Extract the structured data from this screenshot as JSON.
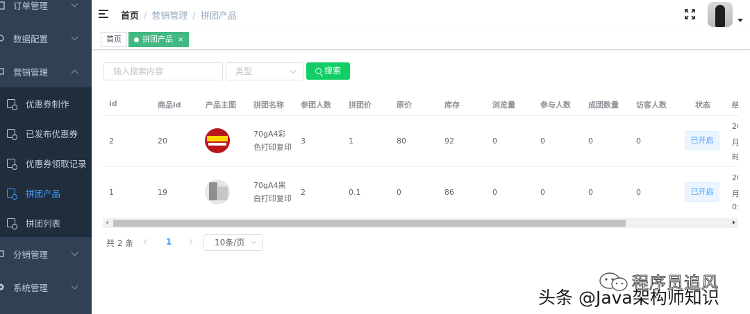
{
  "sidebar": {
    "menus": [
      {
        "label": "订单管理",
        "icon": "order-icon",
        "expanded": false
      },
      {
        "label": "数据配置",
        "icon": "config-icon",
        "expanded": false
      },
      {
        "label": "营销管理",
        "icon": "marketing-icon",
        "expanded": true
      },
      {
        "label": "分销管理",
        "icon": "distribution-icon",
        "expanded": false
      },
      {
        "label": "系统管理",
        "icon": "gear-icon",
        "expanded": false
      }
    ],
    "submenu": [
      {
        "label": "优惠券制作",
        "active": false
      },
      {
        "label": "已发布优惠券",
        "active": false
      },
      {
        "label": "优惠券领取记录",
        "active": false
      },
      {
        "label": "拼团产品",
        "active": true
      },
      {
        "label": "拼团列表",
        "active": false
      }
    ]
  },
  "navbar": {
    "breadcrumb": [
      "首页",
      "营销管理",
      "拼团产品"
    ]
  },
  "tags": [
    {
      "label": "首页",
      "active": false
    },
    {
      "label": "拼团产品",
      "active": true,
      "close": "×"
    }
  ],
  "search": {
    "placeholder": "输入搜索内容",
    "type_placeholder": "类型",
    "button_label": "搜索"
  },
  "table": {
    "columns": [
      "id",
      "商品id",
      "产品主图",
      "拼团名称",
      "参团人数",
      "拼团价",
      "原价",
      "库存",
      "浏览量",
      "参与人数",
      "成团数量",
      "访客人数",
      "状态",
      "结"
    ],
    "rows": [
      {
        "id": "2",
        "product_id": "20",
        "name": "70gA4彩色打印复印",
        "group_size": "3",
        "group_price": "1",
        "original_price": "80",
        "stock": "92",
        "views": "0",
        "participants": "0",
        "groups_formed": "0",
        "visitors": "0",
        "status": "已开启",
        "overflow": [
          "20",
          "月",
          "时"
        ]
      },
      {
        "id": "1",
        "product_id": "19",
        "name": "70gA4黑白打印复印",
        "group_size": "2",
        "group_price": "0.1",
        "original_price": "0",
        "stock": "86",
        "views": "0",
        "participants": "0",
        "groups_formed": "0",
        "visitors": "0",
        "status": "已开启",
        "overflow": [
          "20",
          "月",
          "0:"
        ]
      }
    ]
  },
  "pagination": {
    "total": "共 2 条",
    "current": "1",
    "page_size": "10条/页"
  },
  "watermark": {
    "line1": "程序员追风",
    "line2": "头条 @Java架构师知识"
  },
  "colors": {
    "sidebar_bg": "#304156",
    "submenu_bg": "#1f2d3d",
    "active_link": "#409eff",
    "tag_active": "#42b983",
    "search_button": "#13ce66"
  }
}
